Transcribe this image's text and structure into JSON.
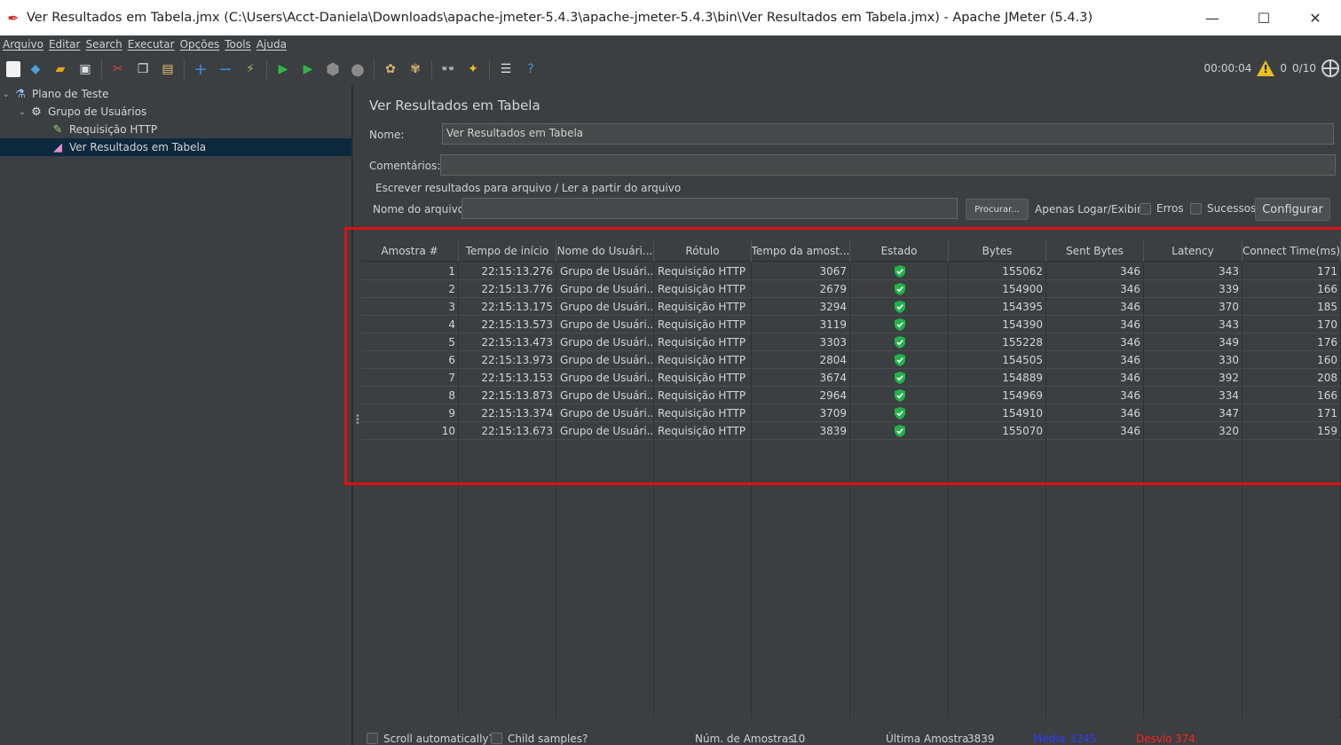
{
  "window": {
    "title": "Ver Resultados em Tabela.jmx (C:\\Users\\Acct-Daniela\\Downloads\\apache-jmeter-5.4.3\\apache-jmeter-5.4.3\\bin\\Ver Resultados em Tabela.jmx) - Apache JMeter (5.4.3)",
    "minimize": "—",
    "maximize": "☐",
    "close": "✕"
  },
  "menu": [
    "Arquivo",
    "Editar",
    "Search",
    "Executar",
    "Opções",
    "Tools",
    "Ajuda"
  ],
  "toolbar": {
    "elapsed": "00:00:04",
    "warnings": "0",
    "threads": "0/10"
  },
  "tree": {
    "items": [
      {
        "label": "Plano de Teste",
        "icon": "flask-icon",
        "toggle": "⌄"
      },
      {
        "label": "Grupo de Usuários",
        "icon": "gear-icon",
        "toggle": "⌄"
      },
      {
        "label": "Requisição HTTP",
        "icon": "pipette-icon",
        "toggle": ""
      },
      {
        "label": "Ver Resultados em Tabela",
        "icon": "chart-icon",
        "toggle": ""
      }
    ]
  },
  "panel": {
    "title": "Ver Resultados em Tabela",
    "name_label": "Nome:",
    "name_value": "Ver Resultados em Tabela",
    "comments_label": "Comentários:",
    "comments_value": "",
    "file_group_title": "Escrever resultados para arquivo / Ler a partir do arquivo",
    "filename_label": "Nome do arquivo",
    "filename_value": "",
    "browse_label": "Procurar...",
    "log_only_label": "Apenas Logar/Exibir",
    "errors_label": "Erros",
    "success_label": "Sucessos",
    "configure_label": "Configurar"
  },
  "table": {
    "columns": [
      "Amostra #",
      "Tempo de início",
      "Nome do Usuári...",
      "Rótulo",
      "Tempo da amost...",
      "Estado",
      "Bytes",
      "Sent Bytes",
      "Latency",
      "Connect Time(ms)"
    ],
    "rows": [
      [
        "1",
        "22:15:13.276",
        "Grupo de Usuári...",
        "Requisição HTTP",
        "3067",
        "ok",
        "155062",
        "346",
        "343",
        "171"
      ],
      [
        "2",
        "22:15:13.776",
        "Grupo de Usuári...",
        "Requisição HTTP",
        "2679",
        "ok",
        "154900",
        "346",
        "339",
        "166"
      ],
      [
        "3",
        "22:15:13.175",
        "Grupo de Usuári...",
        "Requisição HTTP",
        "3294",
        "ok",
        "154395",
        "346",
        "370",
        "185"
      ],
      [
        "4",
        "22:15:13.573",
        "Grupo de Usuári...",
        "Requisição HTTP",
        "3119",
        "ok",
        "154390",
        "346",
        "343",
        "170"
      ],
      [
        "5",
        "22:15:13.473",
        "Grupo de Usuári...",
        "Requisição HTTP",
        "3303",
        "ok",
        "155228",
        "346",
        "349",
        "176"
      ],
      [
        "6",
        "22:15:13.973",
        "Grupo de Usuári...",
        "Requisição HTTP",
        "2804",
        "ok",
        "154505",
        "346",
        "330",
        "160"
      ],
      [
        "7",
        "22:15:13.153",
        "Grupo de Usuári...",
        "Requisição HTTP",
        "3674",
        "ok",
        "154889",
        "346",
        "392",
        "208"
      ],
      [
        "8",
        "22:15:13.873",
        "Grupo de Usuári...",
        "Requisição HTTP",
        "2964",
        "ok",
        "154969",
        "346",
        "334",
        "166"
      ],
      [
        "9",
        "22:15:13.374",
        "Grupo de Usuári...",
        "Requisição HTTP",
        "3709",
        "ok",
        "154910",
        "346",
        "347",
        "171"
      ],
      [
        "10",
        "22:15:13.673",
        "Grupo de Usuári...",
        "Requisição HTTP",
        "3839",
        "ok",
        "155070",
        "346",
        "320",
        "159"
      ]
    ]
  },
  "status": {
    "scroll_label": "Scroll automatically?",
    "child_label": "Child samples?",
    "num_samples_label": "Núm. de Amostras",
    "num_samples_value": "10",
    "last_sample_label": "Última Amostra",
    "last_sample_value": "3839",
    "mean_label": "Média",
    "mean_value": "3245",
    "deviation_label": "Desvio",
    "deviation_value": "374"
  },
  "colors": {
    "highlight": "#e01010",
    "mean": "#2f3cff",
    "deviation": "#ff2020",
    "status_ok": "#21b34a"
  }
}
